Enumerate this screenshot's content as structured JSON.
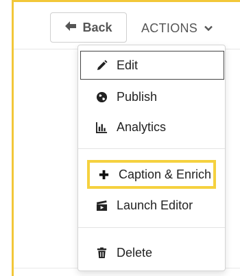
{
  "header": {
    "back_label": "Back",
    "actions_label": "ACTIONS"
  },
  "menu": {
    "items": [
      {
        "label": "Edit",
        "icon": "pencil-icon"
      },
      {
        "label": "Publish",
        "icon": "globe-icon"
      },
      {
        "label": "Analytics",
        "icon": "bar-chart-icon"
      },
      {
        "label": "Caption & Enrich",
        "icon": "plus-icon"
      },
      {
        "label": "Launch Editor",
        "icon": "clapperboard-icon"
      },
      {
        "label": "Delete",
        "icon": "trash-icon"
      }
    ]
  },
  "colors": {
    "highlight": "#f5d13f",
    "frame": "#f2c739"
  }
}
